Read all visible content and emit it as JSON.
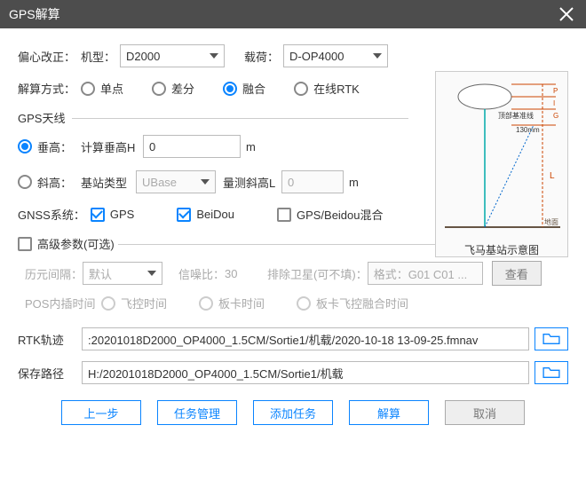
{
  "titlebar": {
    "title": "GPS解算"
  },
  "eccentric": {
    "label": "偏心改正：",
    "model_label": "机型：",
    "model_value": "D2000",
    "payload_label": "载荷：",
    "payload_value": "D-OP4000"
  },
  "solve": {
    "label": "解算方式：",
    "single": "单点",
    "diff": "差分",
    "fusion": "融合",
    "rtk": "在线RTK"
  },
  "antenna": {
    "section": "GPS天线",
    "vert": "垂高：",
    "vert_calc_label": "计算垂高H",
    "vert_value": "0",
    "vert_unit": "m",
    "slant": "斜高：",
    "base_type_label": "基站类型",
    "base_type_value": "UBase",
    "slant_meas_label": "量测斜高L",
    "slant_value": "0",
    "slant_unit": "m"
  },
  "gnss": {
    "label": "GNSS系统：",
    "gps": "GPS",
    "beidou": "BeiDou",
    "mixed": "GPS/Beidou混合"
  },
  "diagram_caption": "飞马基站示意图",
  "diagram_text": {
    "baseline": "顶部基准线",
    "dim": "130mm",
    "ground": "地面"
  },
  "advanced": {
    "label": "高级参数(可选)",
    "epoch_label": "历元间隔：",
    "epoch_value": "默认",
    "snr_label": "信噪比：",
    "snr_value": "30",
    "excl_label": "排除卫星(可不填)：",
    "excl_placeholder": "格式：G01 C01 ...",
    "view_btn": "查看",
    "pos_interp": "POS内插时间",
    "fc_time": "飞控时间",
    "card_time": "板卡时间",
    "fc_card_fusion": "板卡飞控融合时间"
  },
  "paths": {
    "rtk_label": "RTK轨迹",
    "rtk_value": ":20201018D2000_OP4000_1.5CM/Sortie1/机载/2020-10-18 13-09-25.fmnav",
    "save_label": "保存路径",
    "save_value": "H:/20201018D2000_OP4000_1.5CM/Sortie1/机载"
  },
  "footer": {
    "prev": "上一步",
    "task_mgr": "任务管理",
    "add_task": "添加任务",
    "solve": "解算",
    "cancel": "取消"
  }
}
